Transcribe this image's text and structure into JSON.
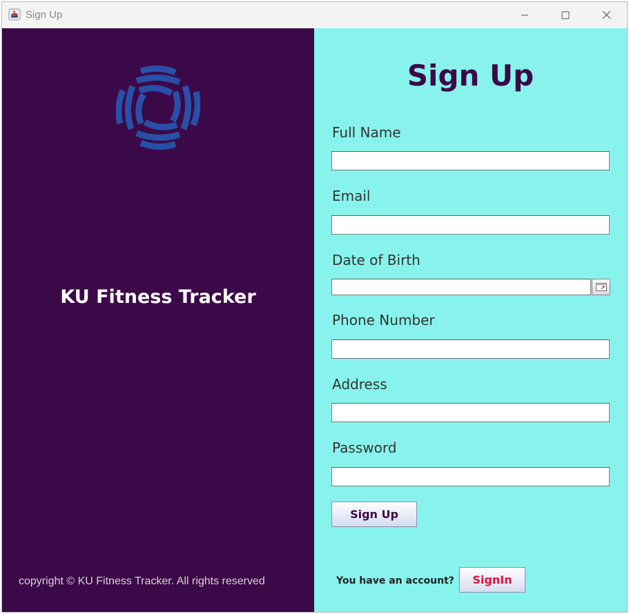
{
  "window": {
    "title": "Sign Up",
    "icons": {
      "app": "java-cup-icon",
      "minimize": "minimize-icon",
      "maximize": "maximize-icon",
      "close": "close-icon"
    }
  },
  "left_panel": {
    "logo_icon": "ku-logo-icon",
    "brand": "KU Fitness Tracker",
    "copyright": "copyright © KU Fitness Tracker. All rights reserved"
  },
  "form": {
    "heading": "Sign Up",
    "fields": {
      "full_name": {
        "label": "Full Name",
        "value": ""
      },
      "email": {
        "label": "Email",
        "value": ""
      },
      "dob": {
        "label": "Date of Birth",
        "value": "",
        "picker_icon": "calendar-icon"
      },
      "phone": {
        "label": "Phone Number",
        "value": ""
      },
      "address": {
        "label": "Address",
        "value": ""
      },
      "password": {
        "label": "Password",
        "value": ""
      }
    },
    "submit_label": "Sign Up",
    "have_account": "You have an account?",
    "signin_label": "SignIn"
  },
  "colors": {
    "left_bg": "#3c0948",
    "right_bg": "#87f3ec",
    "heading": "#3c0948",
    "logo": "#2850a8",
    "signin_text": "#dc143c"
  }
}
